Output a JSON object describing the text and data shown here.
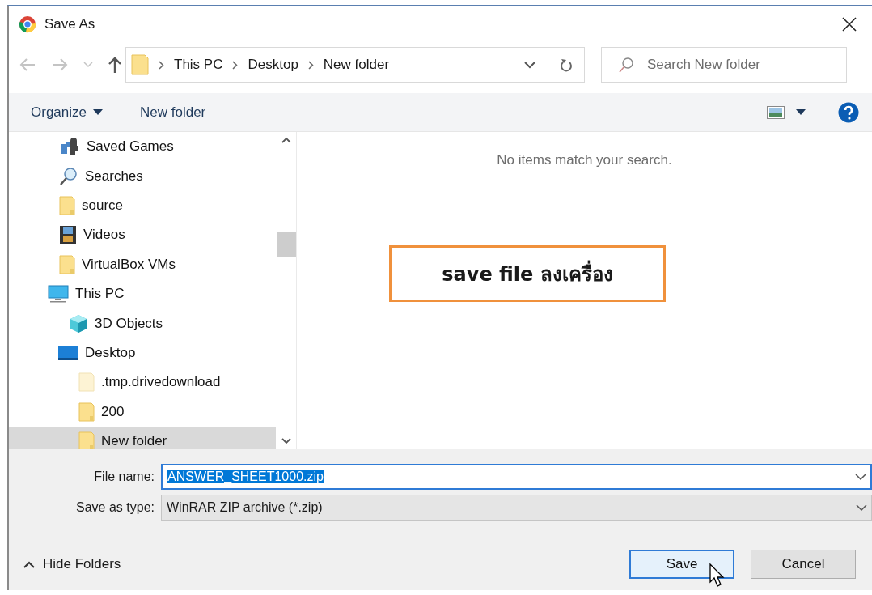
{
  "window": {
    "title": "Save As"
  },
  "address_bar": {
    "crumbs": [
      "This PC",
      "Desktop",
      "New folder"
    ]
  },
  "search": {
    "placeholder": "Search New folder"
  },
  "toolbar": {
    "organize": "Organize",
    "new_folder": "New folder"
  },
  "tree": [
    {
      "label": "Saved Games",
      "kind": "games",
      "selected": false
    },
    {
      "label": "Searches",
      "kind": "search",
      "selected": false
    },
    {
      "label": "source",
      "kind": "folder",
      "selected": false
    },
    {
      "label": "Videos",
      "kind": "video",
      "selected": false
    },
    {
      "label": "VirtualBox VMs",
      "kind": "folder",
      "selected": false
    },
    {
      "label": "This PC",
      "kind": "pc",
      "selected": false,
      "children": [
        {
          "label": "3D Objects",
          "kind": "cube",
          "selected": false
        },
        {
          "label": "Desktop",
          "kind": "desktop",
          "selected": false,
          "children": [
            {
              "label": ".tmp.drivedownload",
              "kind": "hidden-folder",
              "selected": false
            },
            {
              "label": "200",
              "kind": "folder",
              "selected": false
            },
            {
              "label": "New folder",
              "kind": "folder",
              "selected": true
            }
          ]
        }
      ]
    }
  ],
  "content": {
    "empty_message": "No items match your search."
  },
  "annotation": {
    "text": "save file ลงเครื่อง"
  },
  "file_name": {
    "label": "File name:",
    "value": "ANSWER_SHEET1000.zip",
    "text_selected": true
  },
  "save_as_type": {
    "label": "Save as type:",
    "value": "WinRAR ZIP archive (*.zip)"
  },
  "hide_folders": "Hide Folders",
  "buttons": [
    {
      "label": "Save",
      "default": true
    },
    {
      "label": "Cancel",
      "default": false
    }
  ]
}
